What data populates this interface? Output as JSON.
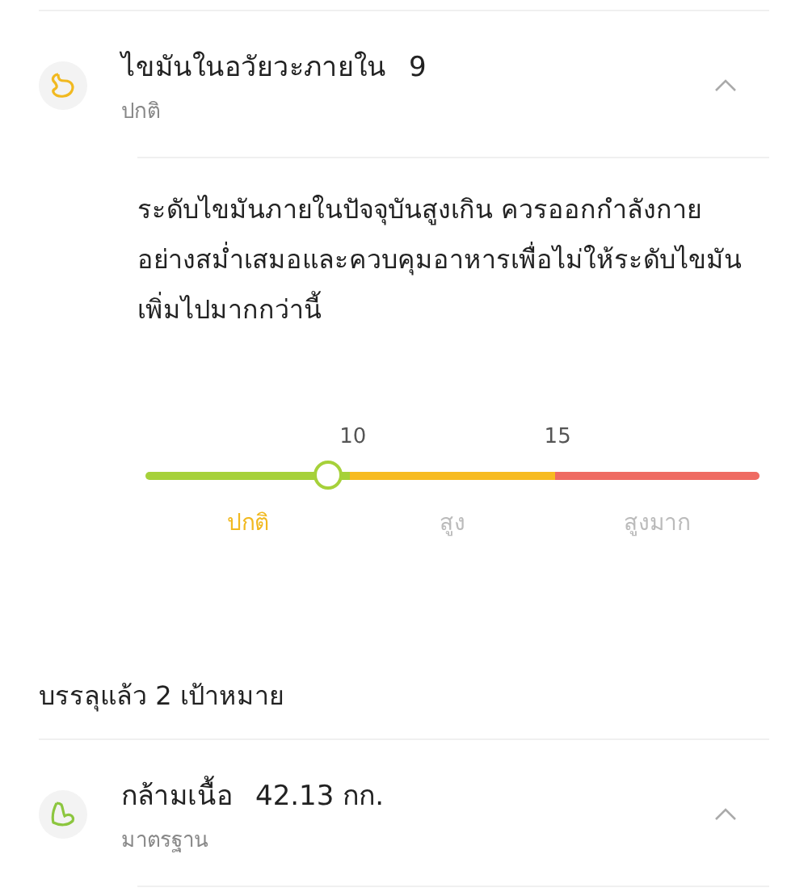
{
  "items": [
    {
      "kind": "stomach",
      "title": "ไขมันในอวัยวะภายใน",
      "value": "9",
      "status": "ปกติ",
      "expanded": true,
      "description": "ระดับไขมันภายในปัจจุบันสูงเกิน ควรออกกำลังกายอย่างสม่ำเสมอและควบคุมอาหารเพื่อไม่ให้ระดับไขมันเพิ่มไปมากกว่านี้",
      "scale": {
        "ticks": [
          "10",
          "15"
        ],
        "level": 0.297,
        "segments": [
          {
            "label": "ปกติ",
            "color": "#a6d13a",
            "selected": true
          },
          {
            "label": "สูง",
            "color": "#f7bb21",
            "selected": false
          },
          {
            "label": "สูงมาก",
            "color": "#ef6b62",
            "selected": false
          }
        ]
      }
    }
  ],
  "section_title": "บรรลุแล้ว 2 เป้าหมาย",
  "achieved": [
    {
      "kind": "arm",
      "title": "กล้ามเนื้อ",
      "value": "42.13 กก.",
      "status": "มาตรฐาน",
      "expanded": true
    }
  ]
}
